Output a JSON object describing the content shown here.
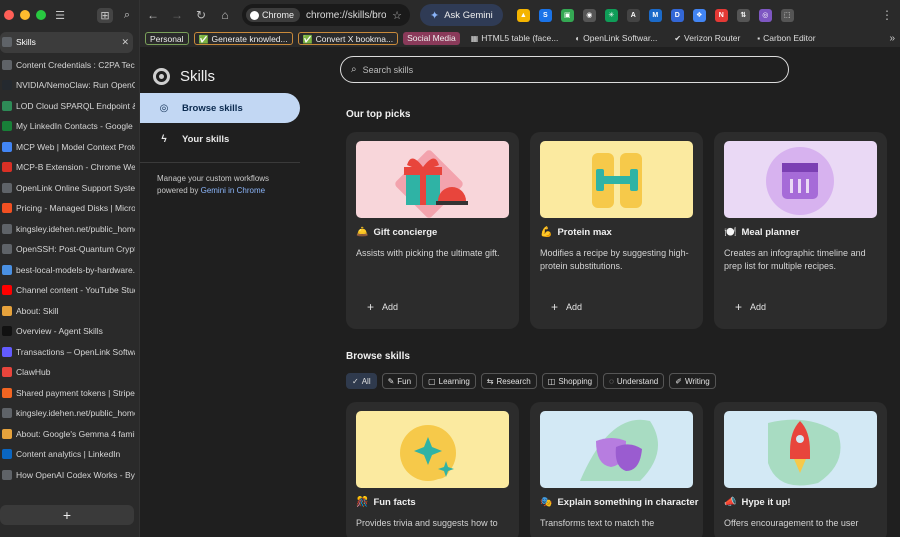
{
  "window": {
    "colors": {
      "close": "#ff5f57",
      "min": "#febc2e",
      "max": "#28c840"
    }
  },
  "tabs": [
    {
      "label": "Skills",
      "icon": "chrome-icon",
      "color": "#5f6368",
      "active": true
    },
    {
      "label": "Content Credentials : C2PA Tech",
      "color": "#5f6368"
    },
    {
      "label": "NVIDIA/NemoClaw: Run OpenClaw",
      "color": "#24292f"
    },
    {
      "label": "LOD Cloud SPARQL Endpoint & Q",
      "color": "#2e8b57"
    },
    {
      "label": "My LinkedIn Contacts - Google S",
      "color": "#188038"
    },
    {
      "label": "MCP Web | Model Context Protoc",
      "color": "#4285f4"
    },
    {
      "label": "MCP-B Extension - Chrome Web S",
      "color": "#d93025"
    },
    {
      "label": "OpenLink Online Support System",
      "color": "#5f6368"
    },
    {
      "label": "Pricing - Managed Disks | Micros",
      "color": "#f25022"
    },
    {
      "label": "kingsley.idehen.net/public_home/",
      "color": "#5f6368"
    },
    {
      "label": "OpenSSH: Post-Quantum Cryptog",
      "color": "#5f6368"
    },
    {
      "label": "best-local-models-by-hardware.m",
      "color": "#4a90e2"
    },
    {
      "label": "Channel content - YouTube Studio",
      "color": "#ff0000"
    },
    {
      "label": "About: Skill",
      "color": "#e6a23c"
    },
    {
      "label": "Overview - Agent Skills",
      "color": "#111111"
    },
    {
      "label": "Transactions – OpenLink Software",
      "color": "#635bff"
    },
    {
      "label": "ClawHub",
      "color": "#e8453c"
    },
    {
      "label": "Shared payment tokens | Stripe D",
      "color": "#f26522"
    },
    {
      "label": "kingsley.idehen.net/public_home/",
      "color": "#5f6368"
    },
    {
      "label": "About: Google's Gemma 4 family",
      "color": "#e6a23c"
    },
    {
      "label": "Content analytics | LinkedIn",
      "color": "#0a66c2"
    },
    {
      "label": "How OpenAI Codex Works - By Ch",
      "color": "#5f6368"
    }
  ],
  "new_tab_label": "+",
  "omnibox": {
    "chip": "Chrome",
    "url": "chrome://skills/browse"
  },
  "gemini_button": "Ask Gemini",
  "extensions": [
    {
      "color": "#f4b400",
      "glyph": "▲"
    },
    {
      "color": "#1a73e8",
      "glyph": "S"
    },
    {
      "color": "#34a853",
      "glyph": "▣"
    },
    {
      "color": "#555555",
      "glyph": "◉"
    },
    {
      "color": "#0f9d58",
      "glyph": "✳"
    },
    {
      "color": "#444444",
      "glyph": "A"
    },
    {
      "color": "#1b6ac9",
      "glyph": "M"
    },
    {
      "color": "#3367d6",
      "glyph": "D"
    },
    {
      "color": "#4285f4",
      "glyph": "❖"
    },
    {
      "color": "#e53935",
      "glyph": "N"
    },
    {
      "color": "#555555",
      "glyph": "⇅"
    },
    {
      "color": "#7e57c2",
      "glyph": "◎"
    },
    {
      "color": "#555555",
      "glyph": "⬚"
    }
  ],
  "bookmarks": [
    {
      "label": "Personal",
      "style": "personal"
    },
    {
      "label": "Generate knowled...",
      "style": "gk",
      "icon": "✅"
    },
    {
      "label": "Convert X bookma...",
      "style": "cx",
      "icon": "✅"
    },
    {
      "label": "Social Media",
      "style": "sm"
    },
    {
      "label": "HTML5 table (face...",
      "style": "plain",
      "icon": "▦"
    },
    {
      "label": "OpenLink Softwar...",
      "style": "plain",
      "icon": "◐"
    },
    {
      "label": "Verizon Router",
      "style": "plain",
      "icon": "✔"
    },
    {
      "label": "Carbon Editor",
      "style": "plain",
      "icon": "▪"
    }
  ],
  "page": {
    "title": "Skills",
    "nav": [
      {
        "label": "Browse skills",
        "icon": "compass-icon",
        "active": true
      },
      {
        "label": "Your skills",
        "icon": "bolt-icon",
        "active": false
      }
    ],
    "description_prefix": "Manage your custom workflows powered by ",
    "description_link": "Gemini in Chrome",
    "search_placeholder": "Search skills",
    "top_picks_title": "Our top picks",
    "top_picks": [
      {
        "emoji": "🛎️",
        "title": "Gift concierge",
        "desc": "Assists with picking the ultimate gift.",
        "add": "Add",
        "bg": "#f8d6da"
      },
      {
        "emoji": "💪",
        "title": "Protein max",
        "desc": "Modifies a recipe by suggesting high-protein substitutions.",
        "add": "Add",
        "bg": "#fbeaa0"
      },
      {
        "emoji": "🍽️",
        "title": "Meal planner",
        "desc": "Creates an infographic timeline and prep list for multiple recipes.",
        "add": "Add",
        "bg": "#ead9f5"
      }
    ],
    "browse_title": "Browse skills",
    "filters": [
      {
        "label": "All",
        "icon": "✓",
        "selected": true
      },
      {
        "label": "Fun",
        "icon": "✎"
      },
      {
        "label": "Learning",
        "icon": "▢"
      },
      {
        "label": "Research",
        "icon": "⇆"
      },
      {
        "label": "Shopping",
        "icon": "◫"
      },
      {
        "label": "Understand",
        "icon": "◌"
      },
      {
        "label": "Writing",
        "icon": "✐"
      }
    ],
    "browse": [
      {
        "emoji": "🎊",
        "title": "Fun facts",
        "desc": "Provides trivia and suggests how to",
        "bg": "#fbeaa0"
      },
      {
        "emoji": "🎭",
        "title": "Explain something in character",
        "desc": "Transforms text to match the",
        "bg": "#d3e9f5"
      },
      {
        "emoji": "📣",
        "title": "Hype it up!",
        "desc": "Offers encouragement to the user",
        "bg": "#d3e9f5"
      }
    ]
  }
}
